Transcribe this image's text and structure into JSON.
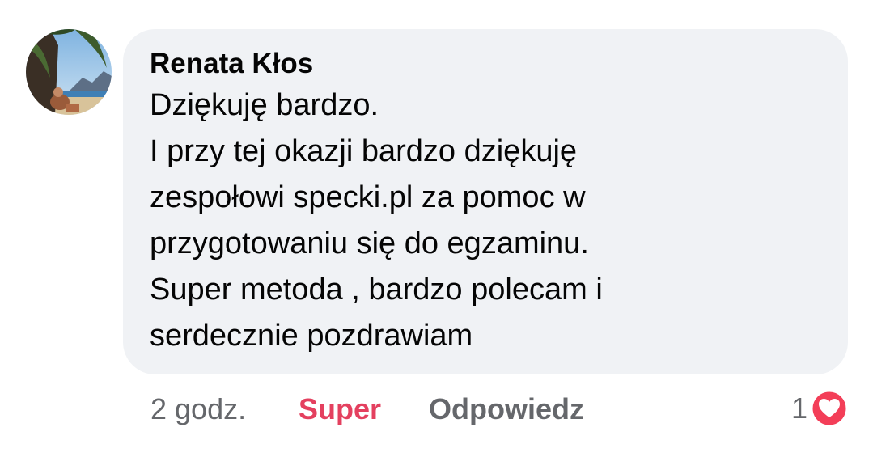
{
  "comment": {
    "author": "Renata Kłos",
    "lines": [
      "Dziękuję bardzo.",
      "I przy tej okazji bardzo dziękuję",
      "zespołowi specki.pl za pomoc w",
      "przygotowaniu się do egzaminu.",
      "Super metoda , bardzo polecam i",
      "serdecznie pozdrawiam"
    ]
  },
  "actions": {
    "time": "2 godz.",
    "reaction_label": "Super",
    "reply_label": "Odpowiedz"
  },
  "reactions": {
    "count": "1",
    "icon": "heart-icon"
  },
  "colors": {
    "bubble": "#f0f2f5",
    "reaction_accent": "#e4405f",
    "secondary_text": "#65676b"
  }
}
